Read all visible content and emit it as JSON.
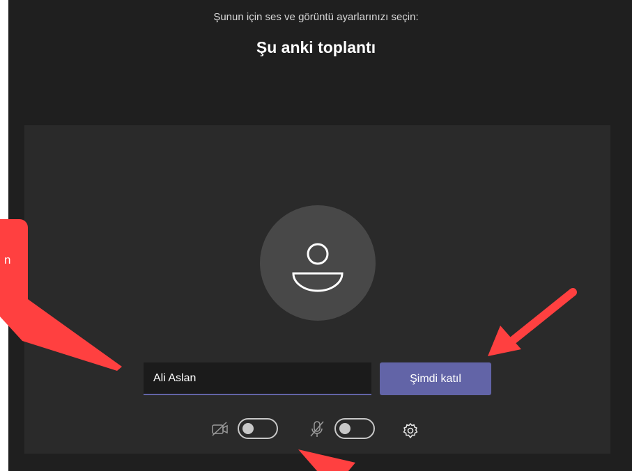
{
  "header": {
    "subtitle": "Şunun için ses ve görüntü ayarlarınızı seçin:",
    "title": "Şu anki toplantı"
  },
  "name_field": {
    "value": "Ali Aslan"
  },
  "join_button": {
    "label": "Şimdi katıl"
  },
  "controls": {
    "camera": {
      "icon": "camera-off-icon",
      "enabled": false
    },
    "microphone": {
      "icon": "microphone-off-icon",
      "enabled": false
    },
    "settings": {
      "icon": "gear-icon"
    }
  },
  "annotation": {
    "callout_text": "n"
  },
  "colors": {
    "accent": "#6264a7",
    "background": "#1f1f1f",
    "preview": "#2a2a2a",
    "annotation": "#ff4040"
  }
}
